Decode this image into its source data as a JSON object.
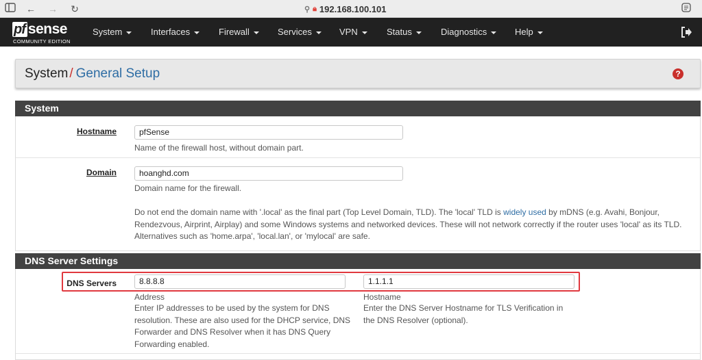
{
  "browser": {
    "address": "192.168.100.101"
  },
  "brand": {
    "logo_pf": "pf",
    "logo_sense": "sense",
    "logo_sub": "COMMUNITY EDITION"
  },
  "nav": {
    "items": [
      "System",
      "Interfaces",
      "Firewall",
      "Services",
      "VPN",
      "Status",
      "Diagnostics",
      "Help"
    ]
  },
  "page": {
    "breadcrumb_root": "System",
    "breadcrumb_sep": "/",
    "breadcrumb_current": "General Setup",
    "help_glyph": "?"
  },
  "system_panel": {
    "title": "System",
    "hostname_label": "Hostname",
    "hostname_value": "pfSense",
    "hostname_help": "Name of the firewall host, without domain part.",
    "domain_label": "Domain",
    "domain_value": "hoanghd.com",
    "domain_help": "Domain name for the firewall.",
    "domain_note_1": "Do not end the domain name with '.local' as the final part (Top Level Domain, TLD). The 'local' TLD is ",
    "domain_note_link": "widely used",
    "domain_note_2": " by mDNS (e.g. Avahi, Bonjour, Rendezvous, Airprint, Airplay) and some Windows systems and networked devices. These will not network correctly if the router uses 'local' as its TLD. Alternatives such as 'home.arpa', 'local.lan', or 'mylocal' are safe."
  },
  "dns_panel": {
    "title": "DNS Server Settings",
    "label": "DNS Servers",
    "address_value": "8.8.8.8",
    "hostname_value": "1.1.1.1",
    "address_sublabel": "Address",
    "address_help": "Enter IP addresses to be used by the system for DNS resolution. These are also used for the DHCP service, DNS Forwarder and DNS Resolver when it has DNS Query Forwarding enabled.",
    "hostname_sublabel": "Hostname",
    "hostname_help": "Enter the DNS Server Hostname for TLS Verification in the DNS Resolver (optional)."
  },
  "colors": {
    "navbar": "#212121",
    "panel_heading": "#424242",
    "breadcrumb_accent": "#c9302c",
    "link": "#2e6da4",
    "highlight_box": "#e0383e"
  }
}
